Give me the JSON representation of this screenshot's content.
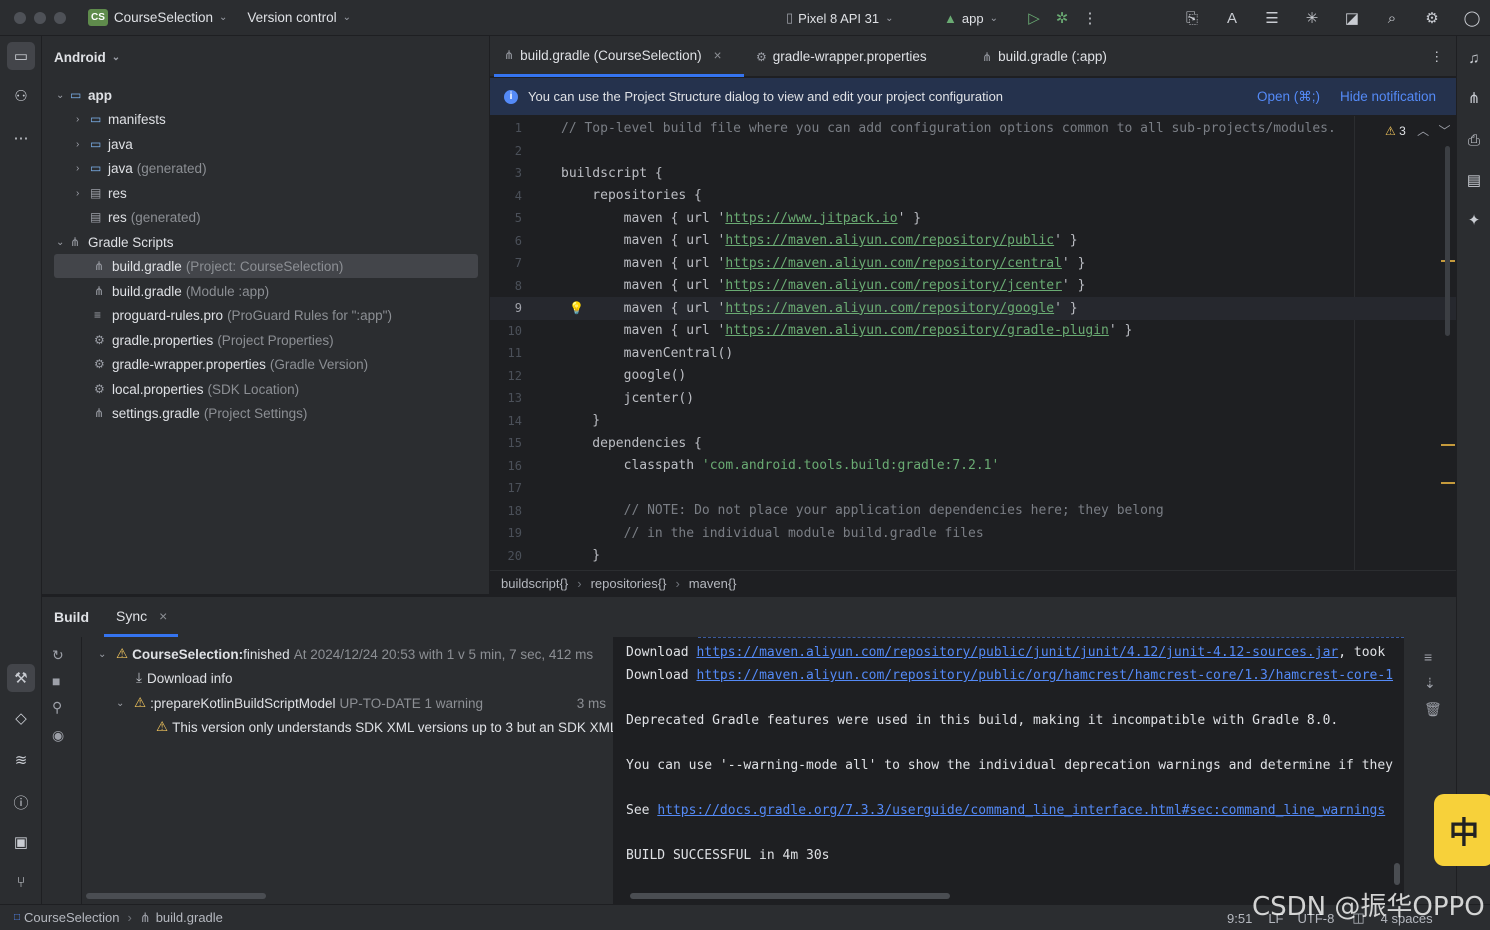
{
  "titlebar": {
    "project_badge": "CS",
    "project_name": "CourseSelection",
    "vcs": "Version control",
    "device": "Pixel 8 API 31",
    "run_config": "app"
  },
  "project_panel": {
    "view": "Android",
    "tree": [
      {
        "label": "app",
        "hint": ""
      },
      {
        "label": "manifests",
        "hint": ""
      },
      {
        "label": "java",
        "hint": ""
      },
      {
        "label": "java",
        "hint": "(generated)"
      },
      {
        "label": "res",
        "hint": ""
      },
      {
        "label": "res",
        "hint": "(generated)"
      },
      {
        "label": "Gradle Scripts",
        "hint": ""
      },
      {
        "label": "build.gradle",
        "hint": "(Project: CourseSelection)"
      },
      {
        "label": "build.gradle",
        "hint": "(Module :app)"
      },
      {
        "label": "proguard-rules.pro",
        "hint": "(ProGuard Rules for \":app\")"
      },
      {
        "label": "gradle.properties",
        "hint": "(Project Properties)"
      },
      {
        "label": "gradle-wrapper.properties",
        "hint": "(Gradle Version)"
      },
      {
        "label": "local.properties",
        "hint": "(SDK Location)"
      },
      {
        "label": "settings.gradle",
        "hint": "(Project Settings)"
      }
    ]
  },
  "editor": {
    "tabs": [
      {
        "label": "build.gradle (CourseSelection)",
        "close": "×"
      },
      {
        "label": "gradle-wrapper.properties"
      },
      {
        "label": "build.gradle (:app)"
      }
    ],
    "notification": {
      "text": "You can use the Project Structure dialog to view and edit your project configuration",
      "open": "Open (⌘;)",
      "hide": "Hide notification"
    },
    "warning_count": "3",
    "lines": [
      {
        "n": "1",
        "pre": "",
        "comment": "// Top-level build file where you can add configuration options common to all sub-projects/modules."
      },
      {
        "n": "2"
      },
      {
        "n": "3",
        "pre": "buildscript {"
      },
      {
        "n": "4",
        "pre": "    repositories {"
      },
      {
        "n": "5",
        "pre": "        maven { url '",
        "url": "https://www.jitpack.io",
        "post": "' }"
      },
      {
        "n": "6",
        "pre": "        maven { url '",
        "url": "https://maven.aliyun.com/repository/public",
        "post": "' }"
      },
      {
        "n": "7",
        "pre": "        maven { url '",
        "url": "https://maven.aliyun.com/repository/central",
        "post": "' }"
      },
      {
        "n": "8",
        "pre": "        maven { url '",
        "url": "https://maven.aliyun.com/repository/jcenter",
        "post": "' }"
      },
      {
        "n": "9",
        "pre": "        maven { url '",
        "url": "https://maven.aliyun.com/repository/google",
        "post": "' }"
      },
      {
        "n": "10",
        "pre": "        maven { url '",
        "url": "https://maven.aliyun.com/repository/gradle-plugin",
        "post": "' }"
      },
      {
        "n": "11",
        "pre": "        mavenCentral()"
      },
      {
        "n": "12",
        "pre": "        google()"
      },
      {
        "n": "13",
        "pre": "        jcenter()"
      },
      {
        "n": "14",
        "pre": "    }"
      },
      {
        "n": "15",
        "pre": "    dependencies {"
      },
      {
        "n": "16",
        "pre": "        classpath ",
        "str": "'com.android.tools.build:gradle:7.2.1'"
      },
      {
        "n": "17"
      },
      {
        "n": "18",
        "pre": "        ",
        "comment": "// NOTE: Do not place your application dependencies here; they belong"
      },
      {
        "n": "19",
        "pre": "        ",
        "comment": "// in the individual module build.gradle files"
      },
      {
        "n": "20",
        "pre": "    }"
      }
    ],
    "breadcrumbs": [
      "buildscript{}",
      "repositories{}",
      "maven{}"
    ]
  },
  "build_panel": {
    "tabs": [
      "Build",
      "Sync"
    ],
    "sync_close": "×",
    "tree": [
      {
        "bold": "CourseSelection:",
        "text": " finished",
        "dim": "At 2024/12/24 20:53 with 1 v 5 min, 7 sec, 412 ms"
      },
      {
        "text": "Download info"
      },
      {
        "text": ":prepareKotlinBuildScriptModel",
        "dim": "UP-TO-DATE 1 warning",
        "time": "3 ms"
      },
      {
        "text": "This version only understands SDK XML versions up to 3 but an SDK XML"
      }
    ],
    "console": [
      {
        "prefix": "Download ",
        "link": "https://maven.aliyun.com/repository/public/junit/junit/4.12/junit-4.12-sources.jar",
        "suffix": ", took"
      },
      {
        "prefix": "Download ",
        "link": "https://maven.aliyun.com/repository/public/org/hamcrest/hamcrest-core/1.3/hamcrest-core-1",
        "suffix": ""
      },
      {
        "prefix": "Deprecated Gradle features were used in this build, making it incompatible with Gradle 8.0."
      },
      {
        "prefix": "You can use '--warning-mode all' to show the individual deprecation warnings and determine if they"
      },
      {
        "prefix": "See ",
        "link": "https://docs.gradle.org/7.3.3/userguide/command_line_interface.html#sec:command_line_warnings",
        "suffix": ""
      },
      {
        "prefix": "BUILD SUCCESSFUL in 4m 30s"
      }
    ]
  },
  "statusbar": {
    "project": "CourseSelection",
    "file": "build.gradle",
    "position": "9:51",
    "line_sep": "LF",
    "encoding": "UTF-8",
    "indent": "4 spaces"
  },
  "ime": "中",
  "watermark": "CSDN @振华OPPO"
}
